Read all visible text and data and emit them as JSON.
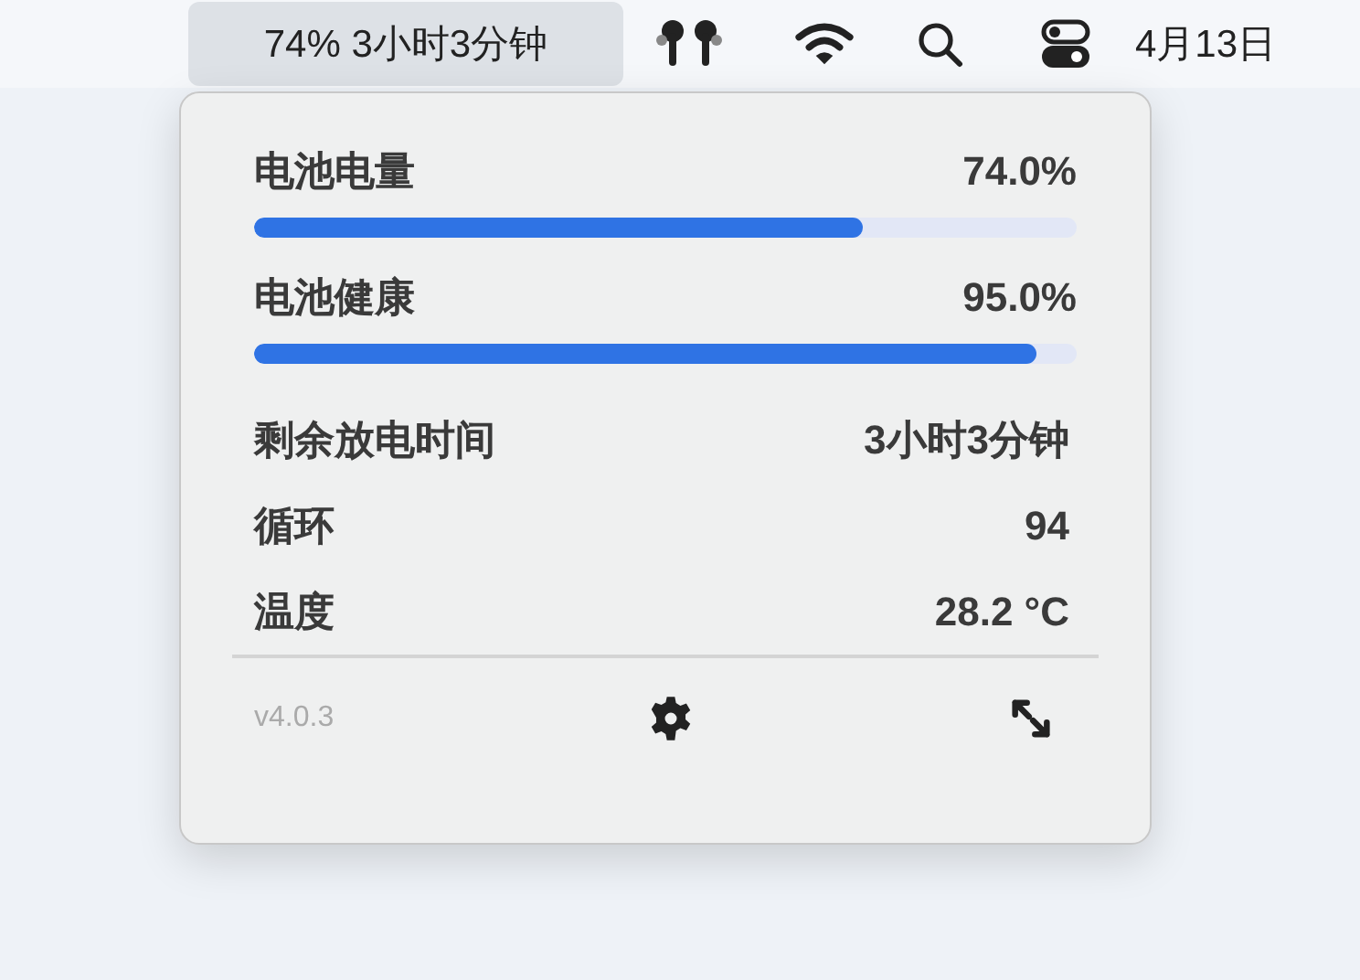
{
  "menu_bar": {
    "battery_status": {
      "text": "74% 3小时3分钟",
      "selected": true
    },
    "date": "4月13日"
  },
  "popover": {
    "meters": [
      {
        "label": "电池电量",
        "value": "74.0%",
        "level": 0.74
      },
      {
        "label": "电池健康",
        "value": "95.0%",
        "level": 0.95
      }
    ],
    "stats": [
      {
        "label": "剩余放电时间",
        "value": "3小时3分钟"
      },
      {
        "label": "循环",
        "value": "94"
      },
      {
        "label": "温度",
        "value": "28.2 °C"
      }
    ],
    "version": "v4.0.3"
  }
}
